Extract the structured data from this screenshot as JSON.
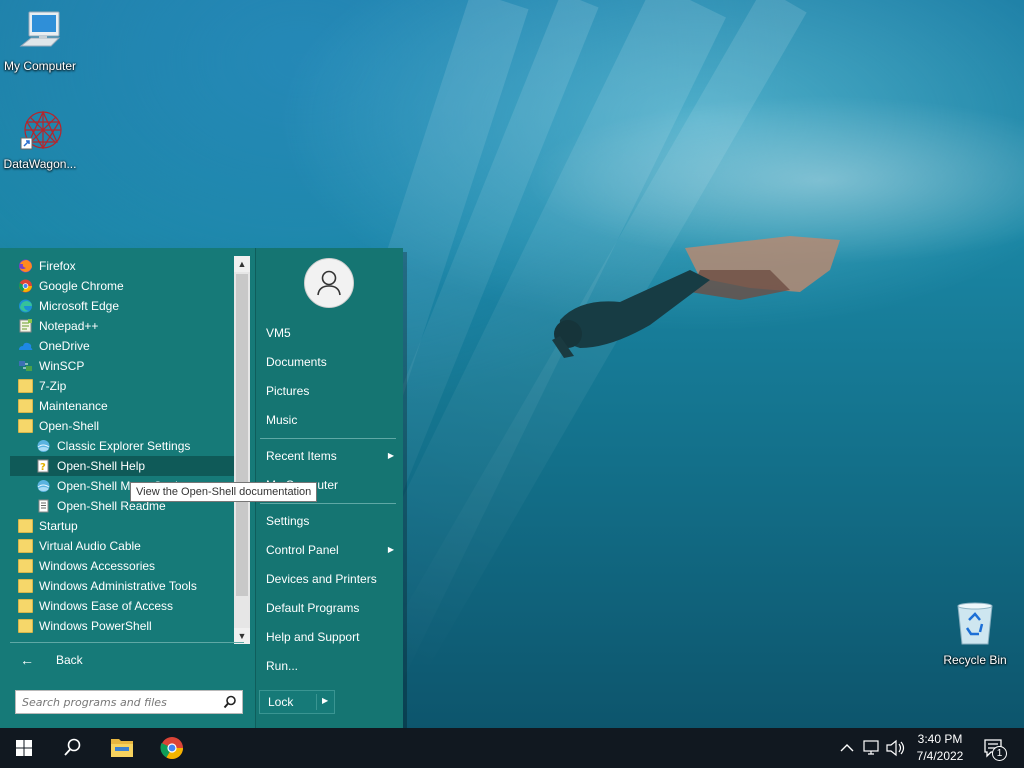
{
  "desktop": {
    "icons": [
      {
        "label": "My Computer",
        "icon": "monitor-icon"
      },
      {
        "label": "DataWagon...",
        "icon": "datawagon-icon"
      },
      {
        "label": "Recycle Bin",
        "icon": "recycle-bin-icon"
      }
    ]
  },
  "start_menu": {
    "programs": [
      {
        "label": "Firefox",
        "icon": "firefox-icon"
      },
      {
        "label": "Google Chrome",
        "icon": "chrome-icon"
      },
      {
        "label": "Microsoft Edge",
        "icon": "edge-icon"
      },
      {
        "label": "Notepad++",
        "icon": "notepadpp-icon"
      },
      {
        "label": "OneDrive",
        "icon": "onedrive-icon"
      },
      {
        "label": "WinSCP",
        "icon": "winscp-icon"
      },
      {
        "label": "7-Zip",
        "icon": "folder-icon"
      },
      {
        "label": "Maintenance",
        "icon": "folder-icon"
      },
      {
        "label": "Open-Shell",
        "icon": "folder-icon"
      },
      {
        "label": "Classic Explorer Settings",
        "icon": "shell-globe-icon"
      },
      {
        "label": "Open-Shell Help",
        "icon": "help-file-icon"
      },
      {
        "label": "Open-Shell Menu Settings",
        "icon": "shell-globe-icon"
      },
      {
        "label": "Open-Shell Readme",
        "icon": "document-icon"
      },
      {
        "label": "Startup",
        "icon": "folder-icon"
      },
      {
        "label": "Virtual Audio Cable",
        "icon": "folder-icon"
      },
      {
        "label": "Windows Accessories",
        "icon": "folder-icon"
      },
      {
        "label": "Windows Administrative Tools",
        "icon": "folder-icon"
      },
      {
        "label": "Windows Ease of Access",
        "icon": "folder-icon"
      },
      {
        "label": "Windows PowerShell",
        "icon": "folder-icon"
      }
    ],
    "back_label": "Back",
    "search_placeholder": "Search programs and files",
    "tooltip": "View the Open-Shell documentation",
    "right_items": {
      "user": "VM5",
      "documents": "Documents",
      "pictures": "Pictures",
      "music": "Music",
      "recent_items": "Recent Items",
      "my_computer": "My Computer",
      "settings": "Settings",
      "control_panel": "Control Panel",
      "devices_printers": "Devices and Printers",
      "default_programs": "Default Programs",
      "help_support": "Help and Support",
      "run": "Run..."
    },
    "lock_label": "Lock"
  },
  "taskbar": {
    "time": "3:40 PM",
    "date": "7/4/2022",
    "notification_count": "1"
  },
  "colors": {
    "menu_bg": "#167a78",
    "selection": "#0f5a58",
    "taskbar": "#111820"
  }
}
